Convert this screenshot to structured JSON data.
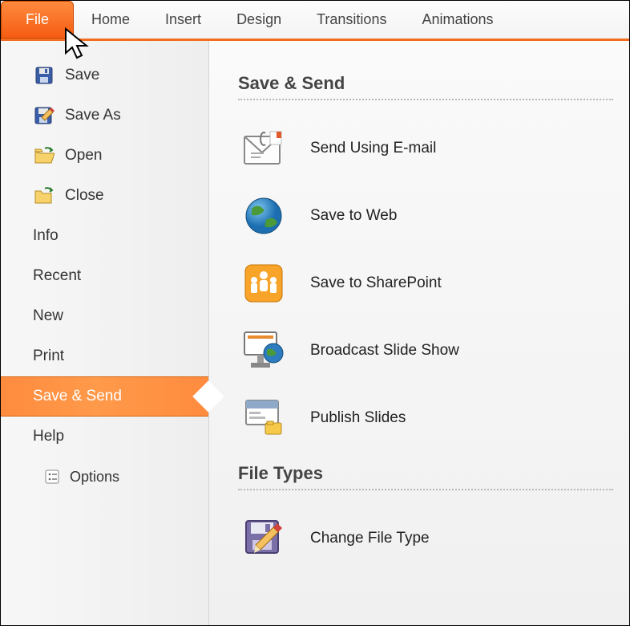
{
  "ribbon": {
    "tabs": {
      "file": "File",
      "home": "Home",
      "insert": "Insert",
      "design": "Design",
      "transitions": "Transitions",
      "animations": "Animations"
    }
  },
  "nav": {
    "save": "Save",
    "saveAs": "Save As",
    "open": "Open",
    "close": "Close",
    "info": "Info",
    "recent": "Recent",
    "new": "New",
    "print": "Print",
    "saveSend": "Save & Send",
    "help": "Help",
    "options": "Options"
  },
  "sections": {
    "saveSend": {
      "title": "Save & Send",
      "sendEmail": "Send Using E-mail",
      "saveWeb": "Save to Web",
      "sharepoint": "Save to SharePoint",
      "broadcast": "Broadcast Slide Show",
      "publish": "Publish Slides"
    },
    "fileTypes": {
      "title": "File Types",
      "change": "Change File Type"
    }
  }
}
